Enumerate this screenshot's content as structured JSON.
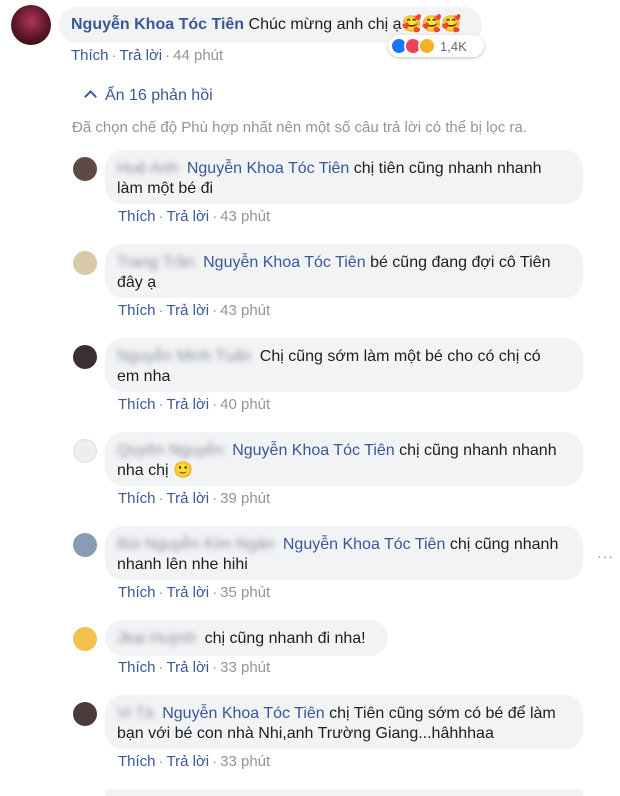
{
  "comment": {
    "author": "Nguyễn Khoa Tóc Tiên",
    "text": "Chúc mừng anh chị ạ",
    "emoji": "🥰🥰🥰",
    "actions": {
      "like": "Thích",
      "reply": "Trả lời",
      "time": "44 phút"
    },
    "reaction_count": "1,4K"
  },
  "hide_replies": "Ẩn 16 phản hồi",
  "filter_note": "Đã chọn chế độ Phù hợp nhất nên một số câu trả lời có thể bị lọc ra.",
  "colors": {
    "link": "#385898",
    "muted": "#90949c",
    "bubble": "#f2f3f5"
  },
  "replies": [
    {
      "blurred_name": "Huệ Anh",
      "mention": "Nguyễn Khoa Tóc Tiên",
      "line1": "chị tiên cũng nhanh nhanh",
      "line2": "làm một bé đi",
      "like": "Thích",
      "reply": "Trả lời",
      "time": "43 phút"
    },
    {
      "blurred_name": "Trang Trần",
      "mention": "Nguyễn Khoa Tóc Tiên",
      "line1": "bé cũng đang đợi cô Tiên",
      "line2": "đây ạ",
      "like": "Thích",
      "reply": "Trả lời",
      "time": "43 phút"
    },
    {
      "blurred_name": "Nguyễn Minh Tuấn",
      "mention": "",
      "line1": "Chị cũng sớm làm một bé cho có chị có",
      "line2": "em nha",
      "like": "Thích",
      "reply": "Trả lời",
      "time": "40 phút"
    },
    {
      "blurred_name": "Quyên Nguyễn",
      "mention": "Nguyễn Khoa Tóc Tiên",
      "line1": "chị cũng nhanh nhanh",
      "line2": "nha chị 🙂",
      "like": "Thích",
      "reply": "Trả lời",
      "time": "39 phút"
    },
    {
      "blurred_name": "Bùi Nguyễn Kim Ngân",
      "mention": "Nguyễn Khoa Tóc Tiên",
      "line1": "chị cũng nhanh",
      "line2": "nhanh lên nhe hihi",
      "like": "Thích",
      "reply": "Trả lời",
      "time": "35 phút"
    },
    {
      "blurred_name": "Jkai Huỳnh",
      "mention": "",
      "line1": "chị cũng nhanh đi nha!",
      "line2": "",
      "like": "Thích",
      "reply": "Trả lời",
      "time": "33 phút"
    },
    {
      "blurred_name": "Vi Tà",
      "mention": "Nguyễn Khoa Tóc Tiên",
      "line1": "chị Tiên cũng sớm có bé để làm",
      "line2": "bạn với bé con nhà Nhi,anh Trường Giang...hâhhhaa",
      "like": "Thích",
      "reply": "Trả lời",
      "time": "33 phút"
    }
  ],
  "more_options": "···"
}
